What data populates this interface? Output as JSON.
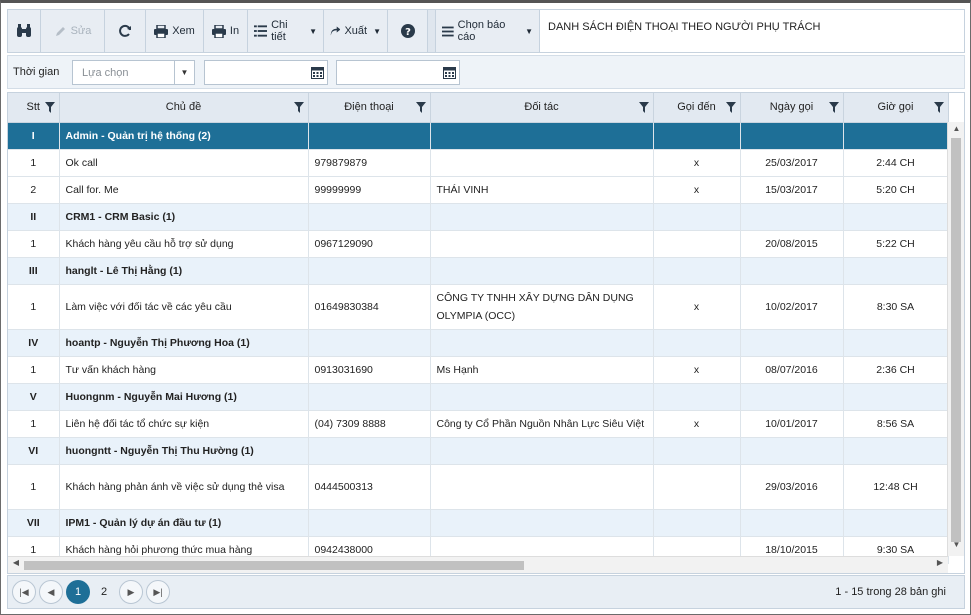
{
  "toolbar": {
    "edit_label": "Sửa",
    "view_label": "Xem",
    "print_label": "In",
    "detail_label": "Chi tiết",
    "export_label": "Xuất",
    "choose_report_label": "Chọn báo cáo",
    "report_title": "DANH SÁCH ĐIỆN THOẠI THEO NGƯỜI PHỤ TRÁCH"
  },
  "filter": {
    "time_label": "Thời gian",
    "select_placeholder": "Lựa chọn",
    "date_from": "",
    "date_to": ""
  },
  "columns": [
    "Stt",
    "Chủ đề",
    "Điện thoại",
    "Đối tác",
    "Gọi đến",
    "Ngày gọi",
    "Giờ gọi"
  ],
  "rows": [
    {
      "type": "group",
      "stt": "I",
      "title": "Admin - Quản trị hệ thống (2)",
      "selected": true
    },
    {
      "type": "data",
      "stt": "1",
      "subject": "Ok call",
      "phone": "979879879",
      "partner": "",
      "incoming": "x",
      "date": "25/03/2017",
      "time": "2:44 CH"
    },
    {
      "type": "data",
      "stt": "2",
      "subject": "Call for. Me",
      "phone": "99999999",
      "partner": "THÁI VINH",
      "incoming": "x",
      "date": "15/03/2017",
      "time": "5:20 CH"
    },
    {
      "type": "group",
      "stt": "II",
      "title": "CRM1 - CRM Basic (1)"
    },
    {
      "type": "data",
      "stt": "1",
      "subject": "Khách hàng yêu cầu hỗ trợ sử dụng",
      "phone": "0967129090",
      "partner": "",
      "incoming": "",
      "date": "20/08/2015",
      "time": "5:22 CH"
    },
    {
      "type": "group",
      "stt": "III",
      "title": "hanglt - Lê Thị Hằng (1)"
    },
    {
      "type": "data",
      "tall": true,
      "stt": "1",
      "subject": "Làm việc với đối tác về các yêu cầu",
      "phone": "01649830384",
      "partner": "CÔNG TY TNHH XÂY DỰNG DÂN DỤNG OLYMPIA (OCC)",
      "incoming": "x",
      "date": "10/02/2017",
      "time": "8:30 SA"
    },
    {
      "type": "group",
      "stt": "IV",
      "title": "hoantp - Nguyễn Thị Phương Hoa (1)"
    },
    {
      "type": "data",
      "stt": "1",
      "subject": "Tư vấn khách hàng",
      "phone": "0913031690",
      "partner": "Ms Hạnh",
      "incoming": "x",
      "date": "08/07/2016",
      "time": "2:36 CH"
    },
    {
      "type": "group",
      "stt": "V",
      "title": "Huongnm - Nguyễn Mai Hương (1)"
    },
    {
      "type": "data",
      "stt": "1",
      "subject": "Liên hệ đối tác tổ chức sự kiện",
      "phone": "(04) 7309 8888",
      "partner": "Công ty Cổ Phần Nguồn Nhân Lực Siêu Việt",
      "incoming": "x",
      "date": "10/01/2017",
      "time": "8:56 SA"
    },
    {
      "type": "group",
      "stt": "VI",
      "title": "huongntt - Nguyễn Thị Thu Hường (1)"
    },
    {
      "type": "data",
      "tall": true,
      "stt": "1",
      "subject": "Khách hàng phản ánh về việc sử dụng thẻ visa",
      "phone": "0444500313",
      "partner": "",
      "incoming": "",
      "date": "29/03/2016",
      "time": "12:48 CH"
    },
    {
      "type": "group",
      "stt": "VII",
      "title": "IPM1 - Quản lý dự án đầu tư (1)"
    },
    {
      "type": "data",
      "stt": "1",
      "subject": "Khách hàng hỏi phương thức mua hàng",
      "phone": "0942438000",
      "partner": "",
      "incoming": "",
      "date": "18/10/2015",
      "time": "9:30 SA"
    }
  ],
  "pager": {
    "pages": [
      "1",
      "2"
    ],
    "current": "1",
    "info": "1 - 15 trong 28 bản ghi"
  },
  "colors": {
    "accent": "#1e6f97",
    "header_bg": "#e2e9f1",
    "group_bg": "#e9f2fa"
  }
}
